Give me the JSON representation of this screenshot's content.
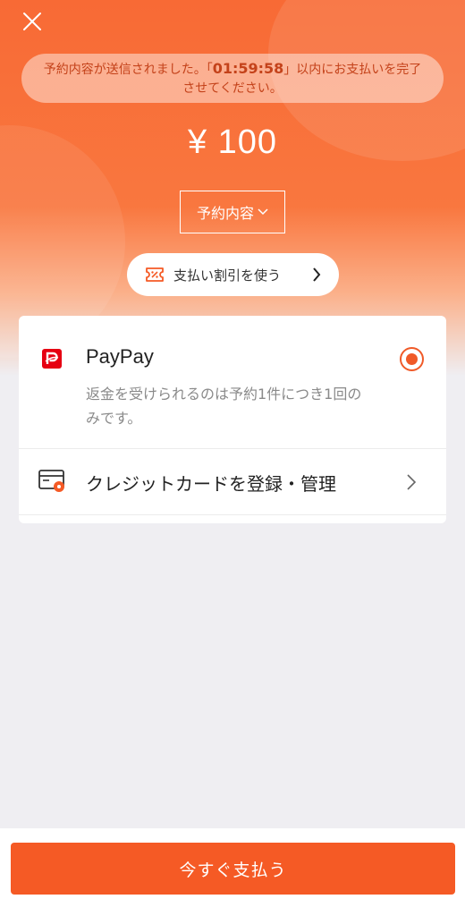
{
  "notice": {
    "prefix": "予約内容が送信されました。「",
    "timer": "01:59:58",
    "suffix": "」以内にお支払いを完了させてください。"
  },
  "amount": "¥ 100",
  "details_button": "予約内容",
  "discount_button": "支払い割引を使う",
  "payment": {
    "method_name": "PayPay",
    "note": "返金を受けられるのは予約1件につき1回のみです。",
    "selected": true
  },
  "credit_card": {
    "label": "クレジットカードを登録・管理"
  },
  "pay_now_button": "今すぐ支払う",
  "colors": {
    "accent": "#f55a25",
    "paypay_red": "#e60012"
  }
}
